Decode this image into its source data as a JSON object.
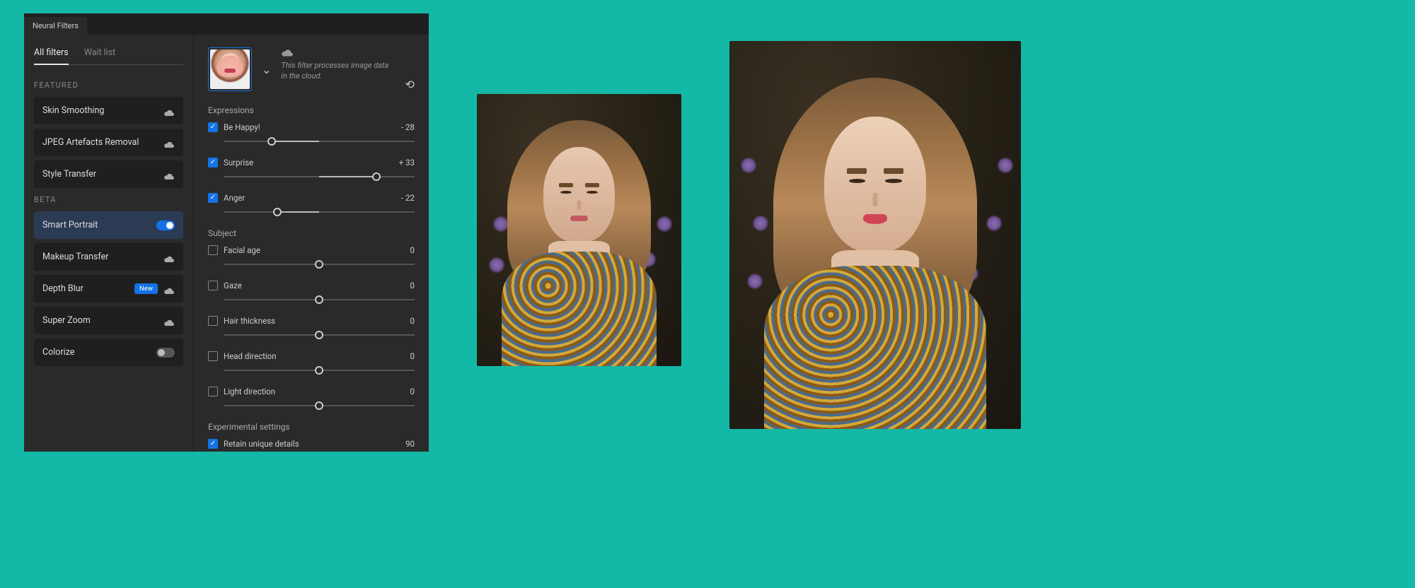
{
  "tab_title": "Neural Filters",
  "side_tabs": {
    "all": "All filters",
    "wait": "Wait list"
  },
  "sections": {
    "featured": "FEATURED",
    "beta": "BETA"
  },
  "filters": {
    "skin": "Skin Smoothing",
    "jpeg": "JPEG Artefacts Removal",
    "style": "Style Transfer",
    "smart": "Smart Portrait",
    "makeup": "Makeup Transfer",
    "depth": "Depth Blur",
    "zoom": "Super Zoom",
    "colorize": "Colorize"
  },
  "badge_new": "New",
  "cloud_note": "This filter processes image data in the cloud.",
  "groups": {
    "expressions": "Expressions",
    "subject": "Subject",
    "experimental": "Experimental settings"
  },
  "sliders": {
    "happy": {
      "label": "Be Happy!",
      "value": "- 28",
      "checked": true,
      "pos": 25,
      "fill_from": 25,
      "fill_to": 50
    },
    "surprise": {
      "label": "Surprise",
      "value": "+ 33",
      "checked": true,
      "pos": 80,
      "fill_from": 50,
      "fill_to": 80
    },
    "anger": {
      "label": "Anger",
      "value": "- 22",
      "checked": true,
      "pos": 28,
      "fill_from": 28,
      "fill_to": 50
    },
    "age": {
      "label": "Facial age",
      "value": "0",
      "checked": false,
      "pos": 50,
      "fill_from": 50,
      "fill_to": 50
    },
    "gaze": {
      "label": "Gaze",
      "value": "0",
      "checked": false,
      "pos": 50,
      "fill_from": 50,
      "fill_to": 50
    },
    "hair": {
      "label": "Hair thickness",
      "value": "0",
      "checked": false,
      "pos": 50,
      "fill_from": 50,
      "fill_to": 50
    },
    "head": {
      "label": "Head direction",
      "value": "0",
      "checked": false,
      "pos": 50,
      "fill_from": 50,
      "fill_to": 50
    },
    "light": {
      "label": "Light direction",
      "value": "0",
      "checked": false,
      "pos": 50,
      "fill_from": 50,
      "fill_to": 50
    },
    "retain": {
      "label": "Retain unique details",
      "value": "90",
      "checked": true,
      "pos": 90,
      "fill_from": 0,
      "fill_to": 90
    }
  }
}
